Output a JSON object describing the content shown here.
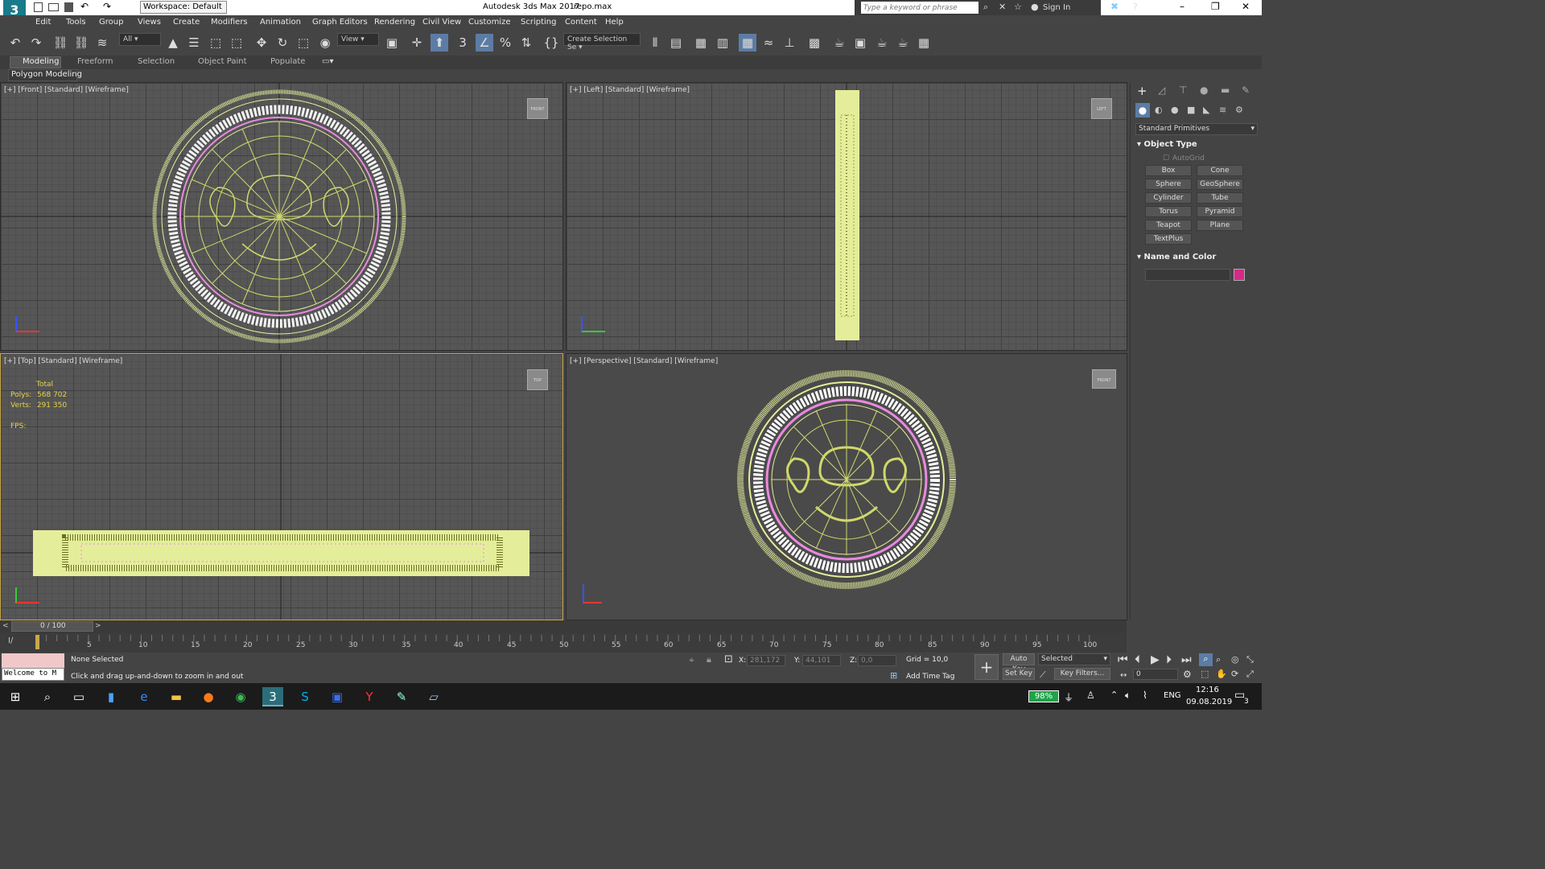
{
  "window": {
    "workspace_label": "Workspace: Default",
    "app_title": "Autodesk 3ds Max 2017",
    "file_name": "repo.max",
    "search_placeholder": "Type a keyword or phrase",
    "sign_in": "Sign In"
  },
  "menu": [
    "Edit",
    "Tools",
    "Group",
    "Views",
    "Create",
    "Modifiers",
    "Animation",
    "Graph Editors",
    "Rendering",
    "Civil View",
    "Customize",
    "Scripting",
    "Content",
    "Help"
  ],
  "toolbar": {
    "filter_value": "All",
    "ref_coord_value": "View",
    "selection_set_placeholder": "Create Selection Se"
  },
  "ribbon": {
    "tabs": [
      "Modeling",
      "Freeform",
      "Selection",
      "Object Paint",
      "Populate"
    ],
    "sub_label": "Polygon Modeling"
  },
  "viewports": {
    "front": {
      "label": "[+] [Front] [Standard] [Wireframe]",
      "cube": "FRONT"
    },
    "left": {
      "label": "[+] [Left] [Standard] [Wireframe]",
      "cube": "LEFT"
    },
    "top": {
      "label": "[+] [Top] [Standard] [Wireframe]",
      "cube": "TOP",
      "stats": {
        "total_label": "Total",
        "polys_label": "Polys:",
        "polys_value": "568 702",
        "verts_label": "Verts:",
        "verts_value": "291 350",
        "fps_label": "FPS:"
      }
    },
    "perspective": {
      "label": "[+] [Perspective] [Standard] [Wireframe]",
      "cube": "FRONT"
    }
  },
  "command_panel": {
    "category_dropdown": "Standard Primitives",
    "object_type_title": "Object Type",
    "autogrid_label": "AutoGrid",
    "buttons": [
      "Box",
      "Cone",
      "Sphere",
      "GeoSphere",
      "Cylinder",
      "Tube",
      "Torus",
      "Pyramid",
      "Teapot",
      "Plane",
      "TextPlus"
    ],
    "name_color_title": "Name and Color",
    "object_color": "#d42a86"
  },
  "timeline": {
    "frame_counter": "0 / 100",
    "ticks": [
      "5",
      "10",
      "15",
      "20",
      "25",
      "30",
      "35",
      "40",
      "45",
      "50",
      "55",
      "60",
      "65",
      "70",
      "75",
      "80",
      "85",
      "90",
      "95",
      "100"
    ]
  },
  "status": {
    "listener_text": "Welcome to M",
    "selection_text": "None Selected",
    "prompt_text": "Click and drag up-and-down to zoom in and out",
    "x_label": "X:",
    "x_value": "281,172",
    "y_label": "Y:",
    "y_value": "44,101",
    "z_label": "Z:",
    "z_value": "0,0",
    "grid_text": "Grid = 10,0",
    "add_time_tag": "Add Time Tag",
    "auto_key": "Auto Key",
    "auto_key_mode": "Selected",
    "set_key": "Set Key",
    "key_filters": "Key Filters...",
    "current_frame": "0"
  },
  "taskbar": {
    "battery": "98%",
    "language": "ENG",
    "time": "12:16",
    "date": "09.08.2019",
    "notifications": "3"
  },
  "colors": {
    "wire": "#e4ee9a",
    "pink": "#e98ae0",
    "highlight": "#c9a74a",
    "stats": "#e8d24a"
  }
}
